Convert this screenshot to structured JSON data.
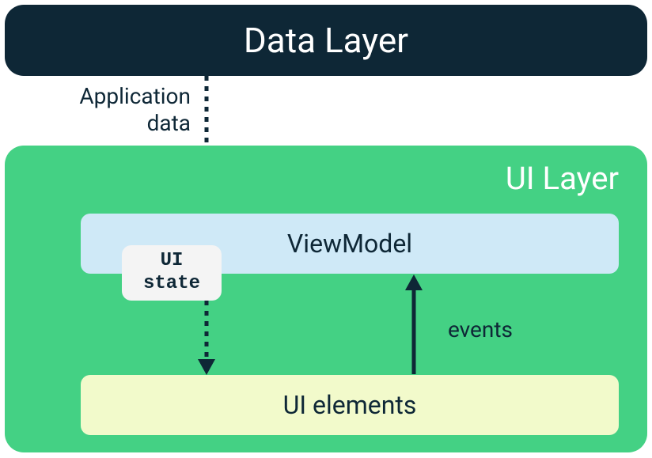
{
  "dataLayer": {
    "title": "Data Layer"
  },
  "flow": {
    "applicationData": "Application\ndata",
    "events": "events"
  },
  "uiLayer": {
    "title": "UI Layer",
    "viewModel": "ViewModel",
    "uiState": "UI\nstate",
    "uiElements": "UI elements"
  },
  "colors": {
    "dataLayerBg": "#0e2736",
    "uiLayerBg": "#44d184",
    "viewModelBg": "#cfe9f7",
    "uiElementsBg": "#f2facb",
    "uiStateBg": "#f4f4f4",
    "arrowColor": "#0e2736"
  }
}
